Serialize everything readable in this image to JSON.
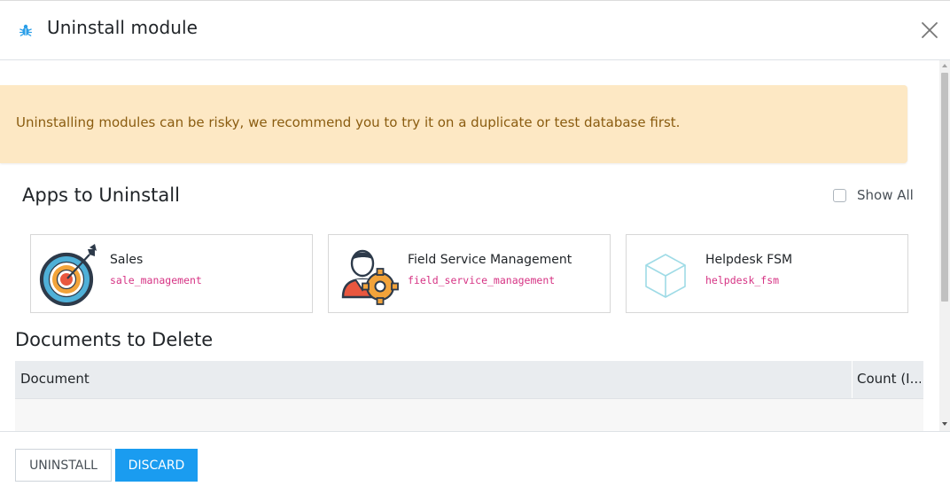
{
  "dialog": {
    "title": "Uninstall module",
    "title_icon": "bug-icon",
    "close_icon": "close-icon"
  },
  "alert": {
    "text": "Uninstalling modules can be risky, we recommend you to try it on a duplicate or test database first.",
    "color": "#fde8c4"
  },
  "apps_section": {
    "title": "Apps to Uninstall",
    "show_all_label": "Show All",
    "show_all_checked": false,
    "apps": [
      {
        "name": "Sales",
        "technical_name": "sale_management",
        "icon": "target-icon"
      },
      {
        "name": "Field Service Management",
        "technical_name": "field_service_management",
        "icon": "technician-gear-icon"
      },
      {
        "name": "Helpdesk FSM",
        "technical_name": "helpdesk_fsm",
        "icon": "cube-icon"
      }
    ]
  },
  "documents_section": {
    "title": "Documents to Delete",
    "columns": [
      "Document",
      "Count (I..."
    ]
  },
  "footer": {
    "uninstall_label": "Uninstall",
    "discard_label": "Discard",
    "accent_color": "#1a9cf0"
  }
}
